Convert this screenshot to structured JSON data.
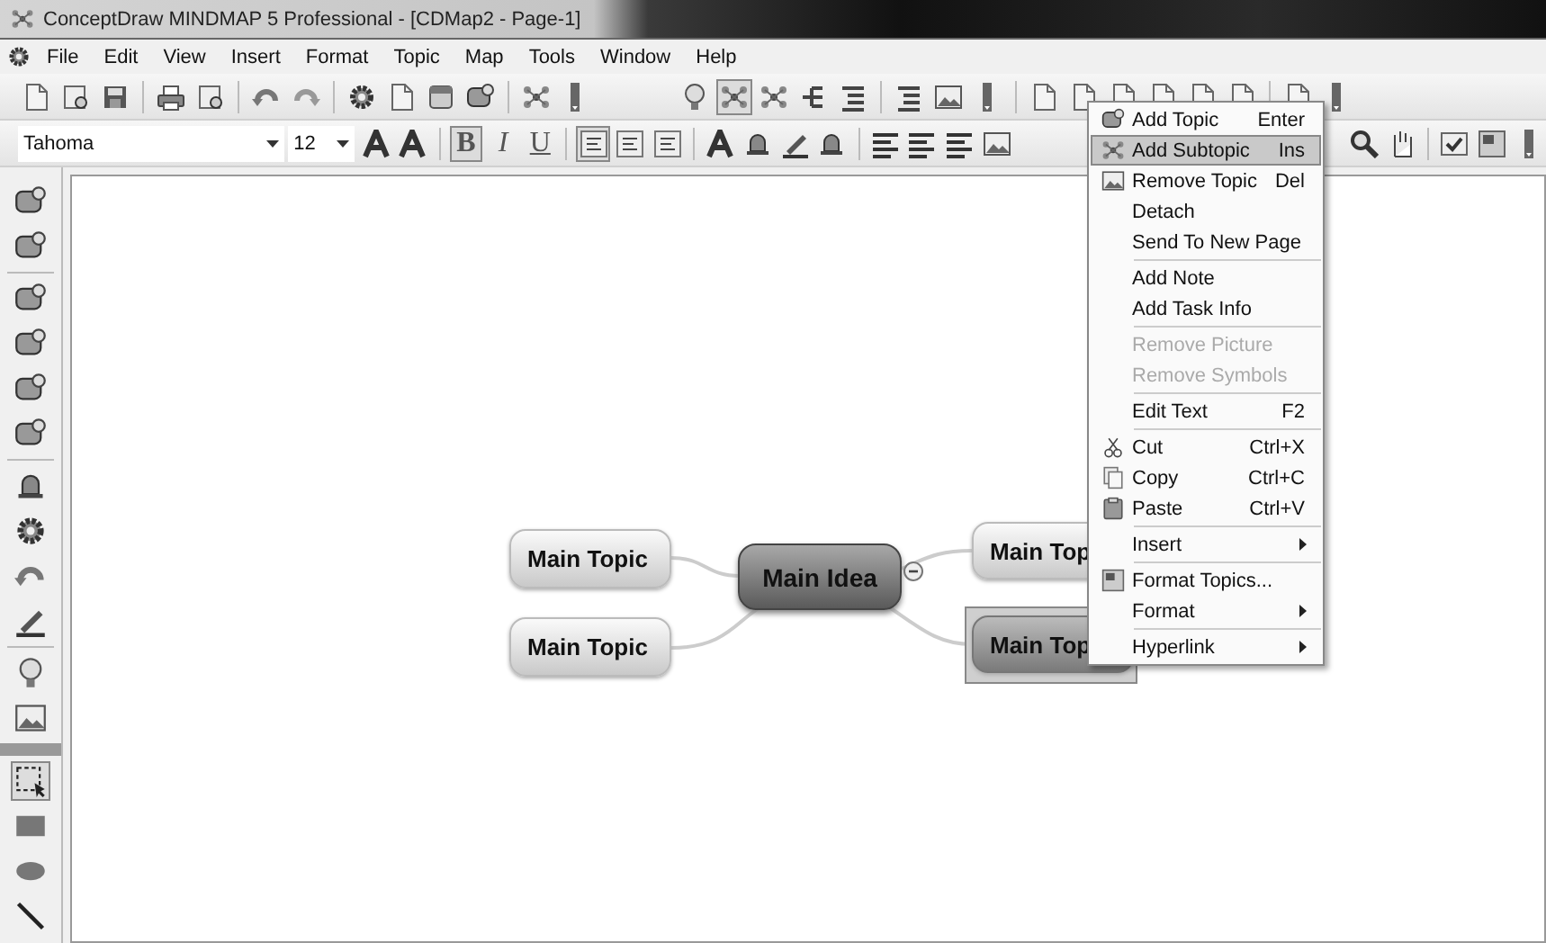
{
  "window": {
    "title": "ConceptDraw MINDMAP 5 Professional - [CDMap2 - Page-1]"
  },
  "menu_bar": [
    "File",
    "Edit",
    "View",
    "Insert",
    "Format",
    "Topic",
    "Map",
    "Tools",
    "Window",
    "Help"
  ],
  "format_toolbar": {
    "font": "Tahoma",
    "size": "12",
    "style_buttons": [
      {
        "label": "B",
        "selected": true
      },
      {
        "label": "I",
        "selected": false
      },
      {
        "label": "U",
        "selected": false
      }
    ]
  },
  "mind_map": {
    "central_topic": {
      "label": "Main Idea",
      "expanded": true
    },
    "topics": [
      {
        "label": "Main Topic",
        "selected": false
      },
      {
        "label": "Main Topic",
        "selected": false
      },
      {
        "label": "Main Top",
        "selected": false
      },
      {
        "label": "Main Top",
        "selected": true
      }
    ]
  },
  "context_menu": {
    "groups": [
      [
        {
          "label": "Add Topic",
          "shortcut": "Enter",
          "kind": "topic",
          "selected": false,
          "disabled": false,
          "submenu": false
        },
        {
          "label": "Add Subtopic",
          "shortcut": "Ins",
          "kind": "subtopic",
          "selected": true,
          "disabled": false,
          "submenu": false
        },
        {
          "label": "Remove Topic",
          "shortcut": "Del",
          "kind": "remove",
          "selected": false,
          "disabled": false,
          "submenu": false
        },
        {
          "label": "Detach",
          "kind": "none",
          "selected": false,
          "disabled": false,
          "submenu": false
        },
        {
          "label": "Send To New Page",
          "kind": "none",
          "selected": false,
          "disabled": false,
          "submenu": false
        }
      ],
      [
        {
          "label": "Add Note",
          "kind": "none",
          "selected": false,
          "disabled": false,
          "submenu": false
        },
        {
          "label": "Add Task Info",
          "kind": "none",
          "selected": false,
          "disabled": false,
          "submenu": false
        }
      ],
      [
        {
          "label": "Remove Picture",
          "kind": "none",
          "selected": false,
          "disabled": true,
          "submenu": false
        },
        {
          "label": "Remove Symbols",
          "kind": "none",
          "selected": false,
          "disabled": true,
          "submenu": false
        }
      ],
      [
        {
          "label": "Edit Text",
          "shortcut": "F2",
          "kind": "none",
          "selected": false,
          "disabled": false,
          "submenu": false
        }
      ],
      [
        {
          "label": "Cut",
          "shortcut": "Ctrl+X",
          "kind": "cut",
          "selected": false,
          "disabled": false,
          "submenu": false
        },
        {
          "label": "Copy",
          "shortcut": "Ctrl+C",
          "kind": "copy",
          "selected": false,
          "disabled": false,
          "submenu": false
        },
        {
          "label": "Paste",
          "shortcut": "Ctrl+V",
          "kind": "paste",
          "selected": false,
          "disabled": false,
          "submenu": false
        }
      ],
      [
        {
          "label": "Insert",
          "kind": "none",
          "selected": false,
          "disabled": false,
          "submenu": true
        }
      ],
      [
        {
          "label": "Format Topics...",
          "kind": "format",
          "selected": false,
          "disabled": false,
          "submenu": false
        },
        {
          "label": "Format",
          "kind": "none",
          "selected": false,
          "disabled": false,
          "submenu": true
        }
      ],
      [
        {
          "label": "Hyperlink",
          "kind": "none",
          "selected": false,
          "disabled": false,
          "submenu": true
        }
      ]
    ]
  }
}
